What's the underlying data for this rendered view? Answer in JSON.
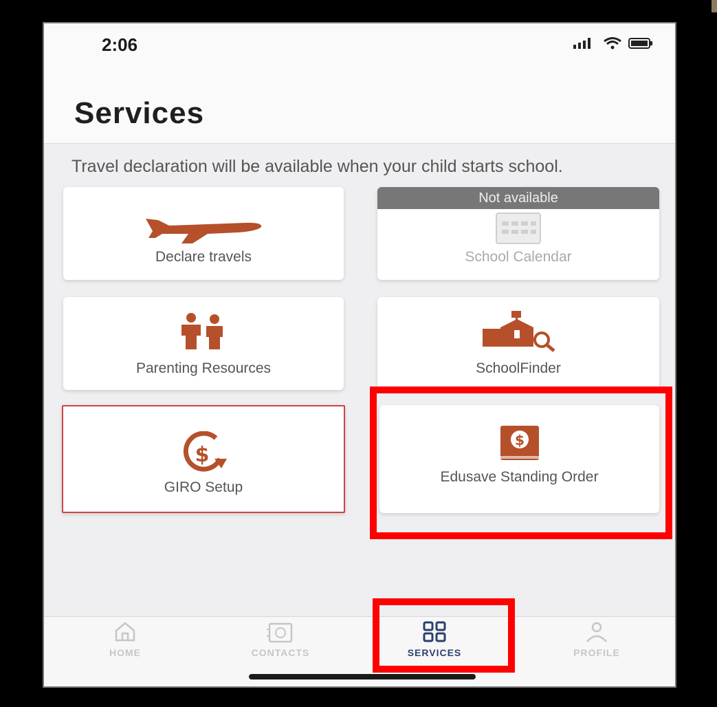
{
  "status_bar": {
    "time": "2:06"
  },
  "header": {
    "title": "Services"
  },
  "notice": "Travel declaration will be available when your child starts school.",
  "tiles": [
    {
      "label": "Declare travels",
      "icon": "airplane-icon"
    },
    {
      "label": "School Calendar",
      "icon": "calendar-icon",
      "banner": "Not available"
    },
    {
      "label": "Parenting Resources",
      "icon": "parents-icon"
    },
    {
      "label": "SchoolFinder",
      "icon": "school-search-icon"
    },
    {
      "label": "GIRO Setup",
      "icon": "dollar-cycle-icon"
    },
    {
      "label": "Edusave Standing Order",
      "icon": "dollar-book-icon"
    }
  ],
  "bottom_nav": [
    {
      "label": "HOME",
      "icon": "home-icon"
    },
    {
      "label": "CONTACTS",
      "icon": "contacts-icon"
    },
    {
      "label": "SERVICES",
      "icon": "grid-icon",
      "active": true
    },
    {
      "label": "PROFILE",
      "icon": "profile-icon"
    }
  ],
  "colors": {
    "accent": "#b5502b",
    "highlight": "#ff0000",
    "nav_active": "#2c3f6d"
  }
}
